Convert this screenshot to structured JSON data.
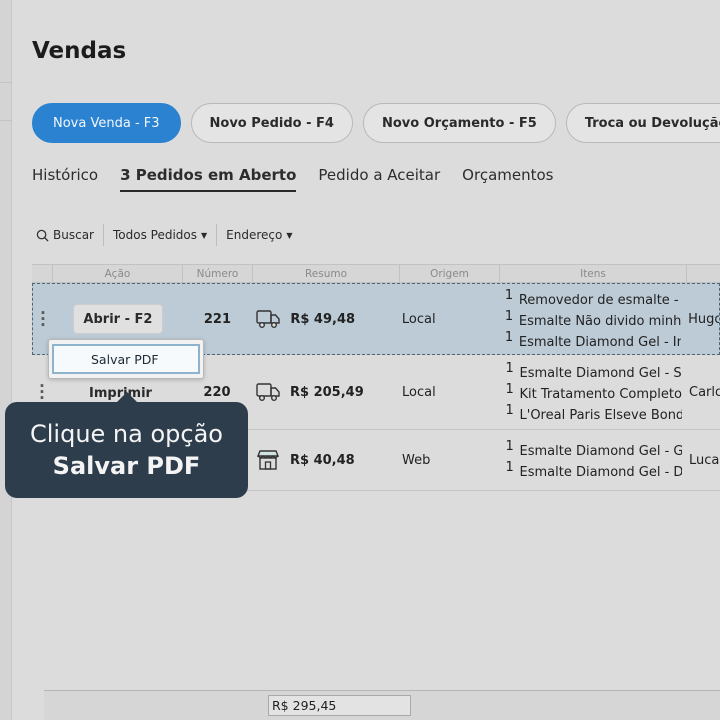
{
  "page": {
    "title": "Vendas"
  },
  "actions": [
    {
      "label": "Nova Venda - F3"
    },
    {
      "label": "Novo Pedido - F4"
    },
    {
      "label": "Novo Orçamento - F5"
    },
    {
      "label": "Troca ou Devolução"
    }
  ],
  "tabs": [
    {
      "label": "Histórico"
    },
    {
      "label": "3 Pedidos em Aberto"
    },
    {
      "label": "Pedido a Aceitar"
    },
    {
      "label": "Orçamentos"
    }
  ],
  "filters": {
    "search": "Buscar",
    "orders": "Todos Pedidos",
    "address": "Endereço"
  },
  "table": {
    "headers": [
      "",
      "Ação",
      "Número",
      "Resumo",
      "Origem",
      "Itens",
      ""
    ],
    "rows": [
      {
        "action": "Abrir - F2",
        "number": "221",
        "total": "R$ 49,48",
        "icon": "truck-icon",
        "origin": "Local",
        "items": [
          "Removedor de esmalte - S",
          "Esmalte Não divido minha",
          "Esmalte Diamond Gel - Int"
        ],
        "qty": [
          "1",
          "1",
          "1"
        ],
        "client": "Hugo"
      },
      {
        "action": "Imprimir",
        "number": "220",
        "total": "R$ 205,49",
        "icon": "truck-icon",
        "origin": "Local",
        "items": [
          "Esmalte Diamond Gel - Se",
          "Kit Tratamento Completo I",
          "L'Oreal Paris Elseve Bond"
        ],
        "qty": [
          "1",
          "1",
          "1"
        ],
        "client": "Carlo"
      },
      {
        "action": "",
        "number": "",
        "total": "R$ 40,48",
        "icon": "store-icon",
        "origin": "Web",
        "items": [
          "Esmalte Diamond Gel - Gin",
          "Esmalte Diamond Gel - Da"
        ],
        "qty": [
          "1",
          "1"
        ],
        "client": "Luca"
      }
    ]
  },
  "dropdown": {
    "item": "Salvar PDF"
  },
  "tooltip": {
    "line1": "Clique na opção",
    "line2": "Salvar PDF"
  },
  "footer": {
    "total": "R$ 295,45"
  },
  "colors": {
    "primary": "#2a82d1",
    "tooltip": "#2d3d4c",
    "selected_row": "#bccbd6"
  }
}
